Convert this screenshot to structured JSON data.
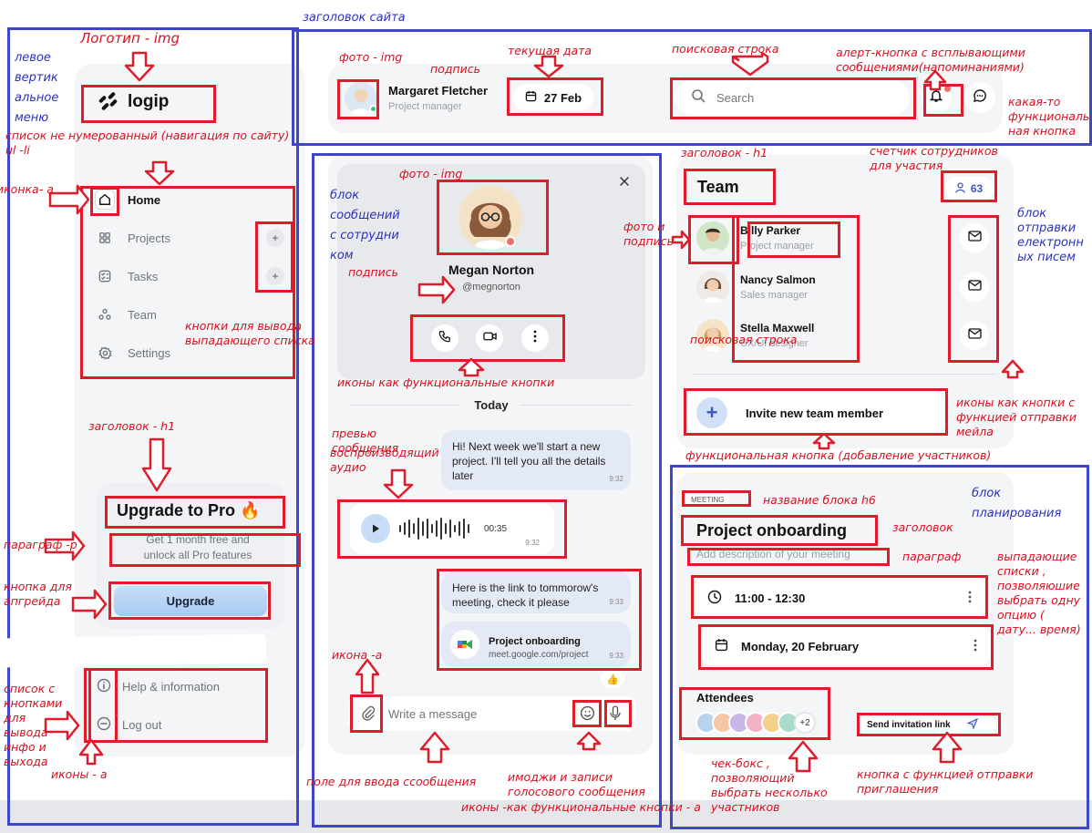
{
  "sidebar": {
    "logo": {
      "text": "logip"
    },
    "nav": [
      {
        "label": "Home",
        "icon": "home-icon",
        "active": true,
        "expandable": false
      },
      {
        "label": "Projects",
        "icon": "grid-icon",
        "active": false,
        "expandable": true
      },
      {
        "label": "Tasks",
        "icon": "checklist-icon",
        "active": false,
        "expandable": true
      },
      {
        "label": "Team",
        "icon": "people-icon",
        "active": false,
        "expandable": false
      },
      {
        "label": "Settings",
        "icon": "gear-icon",
        "active": false,
        "expandable": false
      }
    ],
    "upgrade": {
      "title": "Upgrade to Pro 🔥",
      "text": "Get 1 month free and unlock all Pro features",
      "button": "Upgrade"
    },
    "footer": [
      {
        "label": "Help & information",
        "icon": "info-icon"
      },
      {
        "label": "Log out",
        "icon": "logout-icon"
      }
    ]
  },
  "header": {
    "user": {
      "name": "Margaret Fletcher",
      "role": "Project manager"
    },
    "date": "27 Feb",
    "search": {
      "placeholder": "Search"
    }
  },
  "chat": {
    "contact": {
      "name": "Megan Norton",
      "handle": "@megnorton"
    },
    "day": "Today",
    "messages": [
      {
        "text": "Hi! Next week we'll start a new project. I'll tell you all the details later",
        "time": "9:32"
      },
      {
        "type": "audio",
        "duration": "00:35",
        "time": "9:32"
      },
      {
        "text": "Here is the link to tommorow's meeting, check it please",
        "time": "9:33"
      },
      {
        "type": "link",
        "title": "Project onboarding",
        "url": "meet.google.com/project",
        "time": "9:33"
      }
    ],
    "reaction": "👍",
    "input": {
      "placeholder": "Write a message"
    }
  },
  "team": {
    "title": "Team",
    "count": "63",
    "members": [
      {
        "name": "Billy Parker",
        "role": "Project manager"
      },
      {
        "name": "Nancy Salmon",
        "role": "Sales manager"
      },
      {
        "name": "Stella Maxwell",
        "role": "UX/UI designer"
      }
    ],
    "invite": "Invite new team member"
  },
  "meeting": {
    "tag": "MEETING",
    "title": "Project onboarding",
    "description_placeholder": "Add description of your meeting",
    "time": "11:00 - 12:30",
    "date": "Monday, 20 February",
    "attendees_label": "Attendees",
    "attendees_extra": "+2",
    "send_button": "Send invitation link"
  },
  "annotations": {
    "site_header": "заголовок сайта",
    "logo": "Логотип - img",
    "left_menu": "левое\nвертик\nальное\nменю",
    "nav_list": "список не нумерованный (навигация по сайту)\nul -li",
    "icon_a": "иконка- a",
    "dropdown_buttons": "кнопки для вывода\nвыпадающего списка",
    "h1": "заголовок -  h1",
    "paragraph": "параграф -p",
    "upgrade_btn": "кнопка для\nапгрейда",
    "info_list": "список с\nкнопками\nдля\nвывода\nинфо  и\nвыхода",
    "icons_a": "иконы - а",
    "photo_img": "фото - img",
    "caption": "подпись",
    "current_date": "текущая дата",
    "search_bar": "поисковая строка",
    "alert_btn": "алерт-кнопка с всплывающими\nсообщениями(напоминаниями)",
    "func_btn": "какая-то\nфункциональ\nная кнопка",
    "chat_block": "блок\nсообщений\nс  сотрудни\nком",
    "photo_img2": "фото - img",
    "caption2": "подпись",
    "icons_func": "иконы как функциональные кнопки",
    "preview": "превью\nсообщения",
    "audio_player": "воспроизводящий\nаудио",
    "icon_a2": "икона -а",
    "message_field": "поле для ввода ссообщения",
    "emoji_voice": "имоджи и записи\nголосового сообщения",
    "icons_func2": "иконы -как функциональные кнопки - а",
    "team_h1": "заголовок - h1",
    "counter": "счетчик сотрудников\nдля участия",
    "photo_caption": "фото и\nподпись",
    "mail_block": "блок\nотправки\nелектронн\nых писем",
    "search_line": "поисковая строка",
    "icons_mail": "иконы как кнопки с\nфункцией отправки\nмейла",
    "add_btn": "функциональная кнопка (добавление участников)",
    "planning": "блок\nпланирования",
    "block_name": "название блока  h6",
    "heading": "заголовок",
    "paragraph2": "параграф",
    "dropdowns": "выпадающие\nсписки ,\nпозволяюшие\nвыбрать одну\nопцию (\nдату... время)",
    "checkbox": "чек-бокс  ,\nпозволяющий\nвыбрать несколько\nучастников",
    "invite_btn": "кнопка с функцией отправки\nприглашения"
  }
}
